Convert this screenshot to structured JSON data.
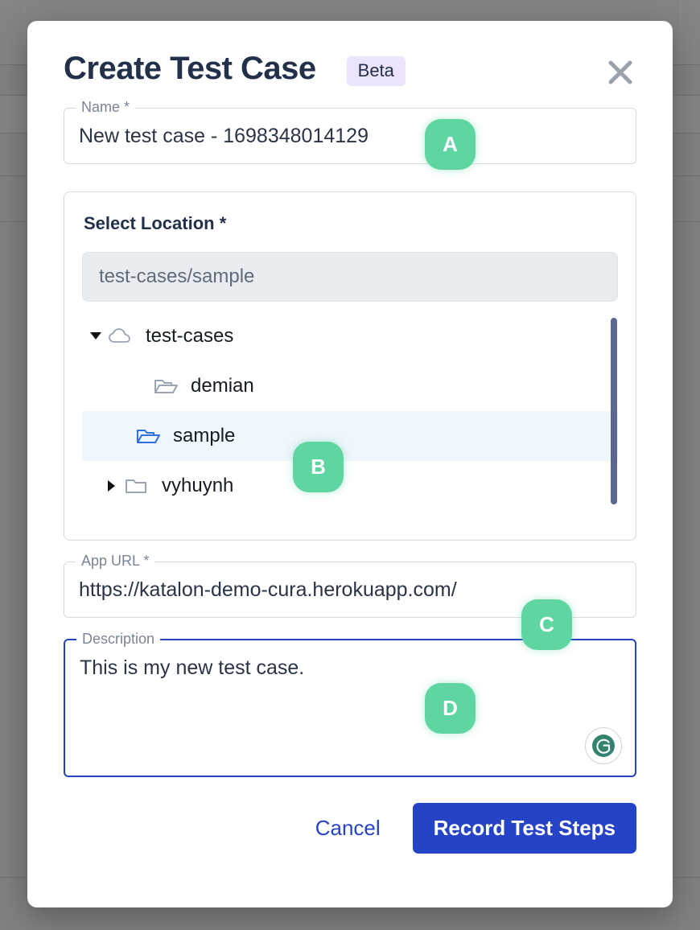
{
  "modal": {
    "title": "Create Test Case",
    "badge": "Beta",
    "close_icon": "close-icon"
  },
  "name_field": {
    "label": "Name *",
    "value": "New test case - 1698348014129"
  },
  "location": {
    "label": "Select Location *",
    "path_value": "test-cases/sample",
    "tree": [
      {
        "label": "test-cases",
        "icon": "cloud-icon",
        "arrow": "expanded",
        "indent": 0,
        "selected": false
      },
      {
        "label": "demian",
        "icon": "folder-open-icon",
        "arrow": "none",
        "indent": 1,
        "selected": false
      },
      {
        "label": "sample",
        "icon": "folder-open-icon",
        "arrow": "none",
        "indent": 1,
        "selected": true
      },
      {
        "label": "vyhuynh",
        "icon": "folder-closed-icon",
        "arrow": "collapsed",
        "indent": 0,
        "selected": false
      }
    ]
  },
  "app_url_field": {
    "label": "App URL *",
    "value": "https://katalon-demo-cura.herokuapp.com/"
  },
  "description_field": {
    "label": "Description",
    "value": "This is my new test case.",
    "assistant_icon": "grammarly-icon"
  },
  "footer": {
    "cancel_label": "Cancel",
    "record_label": "Record Test Steps"
  },
  "annotations": [
    {
      "id": "A",
      "target": "name-field"
    },
    {
      "id": "B",
      "target": "tree-row-sample"
    },
    {
      "id": "C",
      "target": "app-url-field"
    },
    {
      "id": "D",
      "target": "description-field"
    }
  ],
  "colors": {
    "primary": "#2443c7",
    "badge_bg": "#ece4fa",
    "annotation_green": "#5fd6a1",
    "selected_row": "#eff6fd",
    "scrollbar": "#5b6894",
    "overlay": "#808080"
  }
}
